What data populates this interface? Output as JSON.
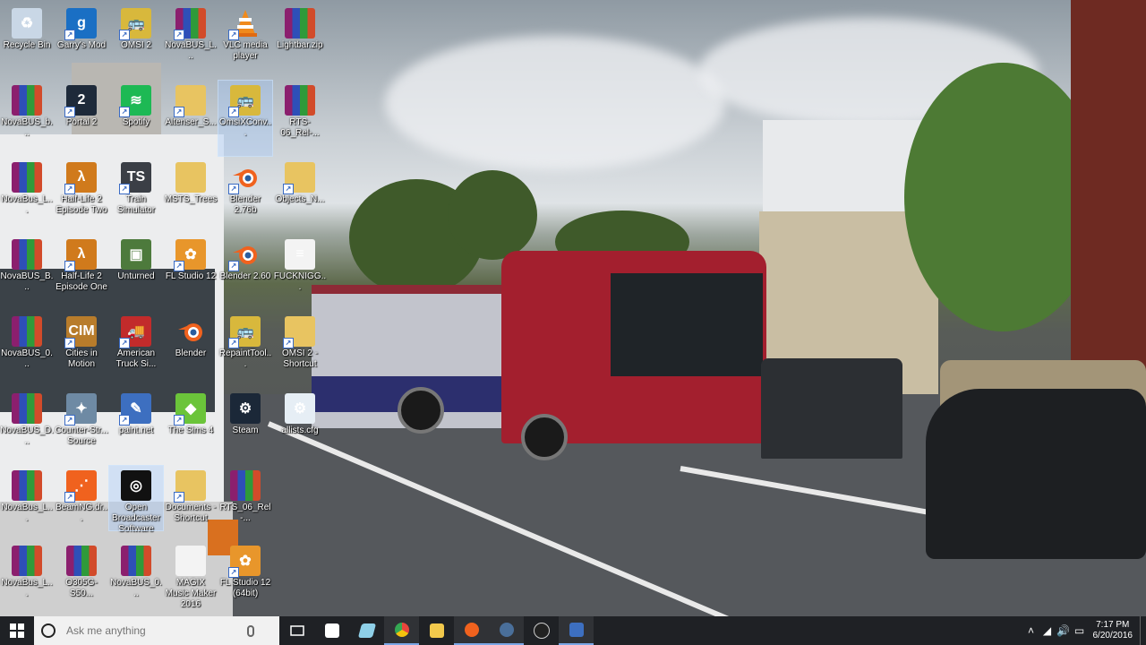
{
  "desktop": {
    "icons": [
      {
        "label": "Recycle Bin",
        "icon": "recycle-bin-icon"
      },
      {
        "label": "Garry's Mod",
        "icon": "garrys-mod-icon",
        "glyph": "g"
      },
      {
        "label": "OMSI 2",
        "icon": "omsi-bus-icon"
      },
      {
        "label": "NovaBUS_L...",
        "icon": "winrar-archive-icon"
      },
      {
        "label": "VLC media player",
        "icon": "vlc-cone-icon"
      },
      {
        "label": "Lightbar.zip",
        "icon": "winrar-archive-icon"
      },
      {
        "label": "NovaBUS_b...",
        "icon": "winrar-archive-icon"
      },
      {
        "label": "Portal 2",
        "icon": "portal-2-icon",
        "glyph": "2"
      },
      {
        "label": "Spotify",
        "icon": "spotify-icon"
      },
      {
        "label": "Altenser_S...",
        "icon": "folder-icon"
      },
      {
        "label": "OmsiXConv...",
        "icon": "omsi-bus-icon"
      },
      {
        "label": "RTS-06_Rel-...",
        "icon": "winrar-archive-icon"
      },
      {
        "label": "NovaBus_L...",
        "icon": "winrar-archive-icon"
      },
      {
        "label": "Half-Life 2 Episode Two",
        "icon": "half-life-icon",
        "glyph": "λ"
      },
      {
        "label": "Train Simulator",
        "icon": "train-simulator-icon",
        "glyph": "TS"
      },
      {
        "label": "MSTS_Trees",
        "icon": "folder-icon"
      },
      {
        "label": "Blender 2.76b",
        "icon": "blender-icon"
      },
      {
        "label": "Objects_N...",
        "icon": "folder-icon"
      },
      {
        "label": "NovaBUS_B...",
        "icon": "winrar-archive-icon"
      },
      {
        "label": "Half-Life 2 Episode One",
        "icon": "half-life-icon",
        "glyph": "λ"
      },
      {
        "label": "Unturned",
        "icon": "unturned-icon"
      },
      {
        "label": "FL Studio 12",
        "icon": "fl-studio-icon"
      },
      {
        "label": "Blender 2.60",
        "icon": "blender-icon"
      },
      {
        "label": "FUCKNIGG...",
        "icon": "text-document-icon"
      },
      {
        "label": "NovaBUS_0...",
        "icon": "winrar-archive-icon"
      },
      {
        "label": "Cities in Motion",
        "icon": "cities-in-motion-icon",
        "glyph": "CIM"
      },
      {
        "label": "American Truck Si...",
        "icon": "american-truck-icon"
      },
      {
        "label": "Blender",
        "icon": "blender-icon"
      },
      {
        "label": "RepaintTool...",
        "icon": "omsi-bus-icon"
      },
      {
        "label": "OMSI 2 - Shortcut",
        "icon": "folder-icon"
      },
      {
        "label": "NovaBUS_D...",
        "icon": "winrar-archive-icon"
      },
      {
        "label": "Counter-Str... Source",
        "icon": "counter-strike-icon"
      },
      {
        "label": "paint.net",
        "icon": "paint-net-icon"
      },
      {
        "label": "The Sims 4",
        "icon": "sims-icon"
      },
      {
        "label": "Steam",
        "icon": "steam-icon"
      },
      {
        "label": "allists.cfg",
        "icon": "config-file-icon"
      },
      {
        "label": "NovaBus_L...",
        "icon": "winrar-archive-icon"
      },
      {
        "label": "BeamNG.dr...",
        "icon": "beamng-icon"
      },
      {
        "label": "Open Broadcaster Software",
        "icon": "obs-icon"
      },
      {
        "label": "Documents - Shortcut",
        "icon": "documents-icon"
      },
      {
        "label": "RTS_06_Rel-...",
        "icon": "winrar-archive-icon"
      },
      {
        "label": "NovaBus_L...",
        "icon": "winrar-archive-icon"
      },
      {
        "label": "O305G-S50...",
        "icon": "winrar-archive-icon"
      },
      {
        "label": "NovaBUS_0...",
        "icon": "winrar-archive-icon"
      },
      {
        "label": "MAGIX Music Maker 2016",
        "icon": "blank-document-icon"
      },
      {
        "label": "FL Studio 12 (64bit)",
        "icon": "fl-studio-icon"
      }
    ]
  },
  "taskbar": {
    "search_placeholder": "Ask me anything",
    "apps": [
      {
        "name": "task-view-icon",
        "color": "#ffffff"
      },
      {
        "name": "store-icon",
        "color": "#ffffff"
      },
      {
        "name": "pinned-app-icon",
        "color": "#8fd0e8"
      },
      {
        "name": "chrome-icon",
        "color": "#e8453c"
      },
      {
        "name": "file-explorer-icon",
        "color": "#f2c94c"
      },
      {
        "name": "blender-taskbar-icon",
        "color": "#f0621e"
      },
      {
        "name": "steam-taskbar-icon",
        "color": "#4a6f9a"
      },
      {
        "name": "obs-taskbar-icon",
        "color": "#222222"
      },
      {
        "name": "paint-net-taskbar-icon",
        "color": "#3d6fc0"
      }
    ],
    "time": "7:17 PM",
    "date": "6/20/2016"
  }
}
